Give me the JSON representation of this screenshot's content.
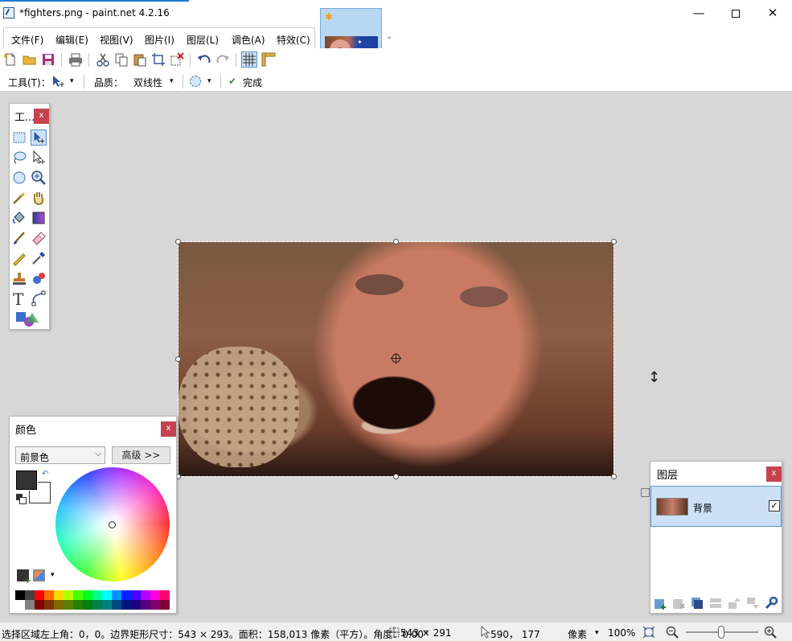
{
  "window": {
    "title": "*fighters.png - paint.net 4.2.16",
    "min_glyph": "—",
    "close_glyph": "✕"
  },
  "menu": {
    "items": [
      "文件(F)",
      "编辑(E)",
      "视图(V)",
      "图片(I)",
      "图层(L)",
      "调色(A)",
      "特效(C)"
    ]
  },
  "document_tab": {
    "star_glyph": "✱",
    "dropdown_glyph": "⌄"
  },
  "toolbar_options": {
    "tool_label": "工具(T)：",
    "quality_label": "品质：",
    "quality_value": "双线性",
    "finish_label": "完成",
    "dropdown_glyph": "▾",
    "check_glyph": "✔"
  },
  "tools_window": {
    "title": "工...",
    "close_glyph": "x"
  },
  "colors_window": {
    "title": "颜色",
    "close_glyph": "x",
    "mode_value": "前景色",
    "mode_arrow": "⌵",
    "advanced_label": "高级 >>",
    "swap_glyph": "↶",
    "palette_arrow": "▾",
    "primary_color": "#333333",
    "secondary_color": "#ffffff",
    "palette_top": [
      "#000000",
      "#404040",
      "#ff0000",
      "#ff6a00",
      "#ffd800",
      "#b6ff00",
      "#4cff00",
      "#00ff21",
      "#00ff90",
      "#00ffff",
      "#0094ff",
      "#0026ff",
      "#4800ff",
      "#b200ff",
      "#ff00dc",
      "#ff006e"
    ],
    "palette_bottom": [
      "#ffffff",
      "#808080",
      "#7f0000",
      "#7f3300",
      "#7f6a00",
      "#5b7f00",
      "#267f00",
      "#007f0e",
      "#007f46",
      "#007f7f",
      "#004a7f",
      "#00137f",
      "#21007f",
      "#57007f",
      "#7f006e",
      "#7f0037"
    ]
  },
  "layers_window": {
    "title": "图层",
    "close_glyph": "x",
    "layer_name": "背景",
    "visible_glyph": "✓"
  },
  "statusbar": {
    "selection_info": "选择区域左上角：0，0。边界矩形尺寸：543 × 293。面积：158,013 像素（平方）。角度：0.00°",
    "selection_size": "543 × 291",
    "cursor_pos": "590， 177",
    "units": "像素",
    "units_arrow": "▾",
    "zoom": "100%",
    "zoom_out_glyph": "−",
    "zoom_in_glyph": "+"
  },
  "cursor_glyph": "↕",
  "icons": {
    "settings": "⚙",
    "help": "?"
  }
}
